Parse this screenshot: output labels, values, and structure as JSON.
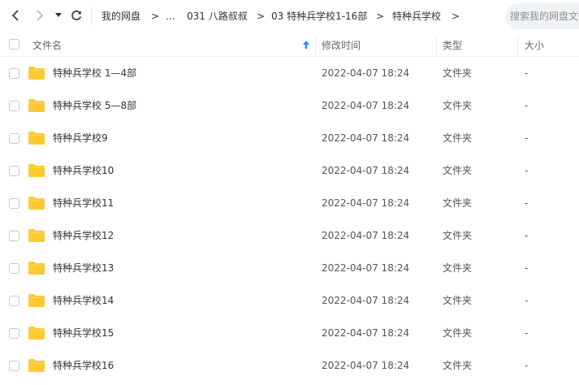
{
  "toolbar": {
    "back_icon": "chevron-left-icon",
    "forward_icon": "chevron-right-icon",
    "history_icon": "caret-down-icon",
    "refresh_icon": "refresh-icon",
    "breadcrumbs": [
      "我的网盘",
      "...",
      "031 八路叔叔",
      "03 特种兵学校1-16部",
      "特种兵学校"
    ],
    "crumb_separator": ">"
  },
  "search": {
    "placeholder": "搜索我的网盘文件"
  },
  "table": {
    "headers": {
      "name": "文件名",
      "modified": "修改时间",
      "type": "类型",
      "size": "大小"
    },
    "sort_icon": "sort-up-arrow-icon",
    "accent_color": "#2b88f0",
    "folder_color": "#ffc933",
    "rows": [
      {
        "name": "特种兵学校 1—4部",
        "modified": "2022-04-07 18:24",
        "type": "文件夹",
        "size": "-"
      },
      {
        "name": "特种兵学校 5—8部",
        "modified": "2022-04-07 18:24",
        "type": "文件夹",
        "size": "-"
      },
      {
        "name": "特种兵学校9",
        "modified": "2022-04-07 18:24",
        "type": "文件夹",
        "size": "-"
      },
      {
        "name": "特种兵学校10",
        "modified": "2022-04-07 18:24",
        "type": "文件夹",
        "size": "-"
      },
      {
        "name": "特种兵学校11",
        "modified": "2022-04-07 18:24",
        "type": "文件夹",
        "size": "-"
      },
      {
        "name": "特种兵学校12",
        "modified": "2022-04-07 18:24",
        "type": "文件夹",
        "size": "-"
      },
      {
        "name": "特种兵学校13",
        "modified": "2022-04-07 18:24",
        "type": "文件夹",
        "size": "-"
      },
      {
        "name": "特种兵学校14",
        "modified": "2022-04-07 18:24",
        "type": "文件夹",
        "size": "-"
      },
      {
        "name": "特种兵学校15",
        "modified": "2022-04-07 18:24",
        "type": "文件夹",
        "size": "-"
      },
      {
        "name": "特种兵学校16",
        "modified": "2022-04-07 18:24",
        "type": "文件夹",
        "size": "-"
      }
    ]
  }
}
